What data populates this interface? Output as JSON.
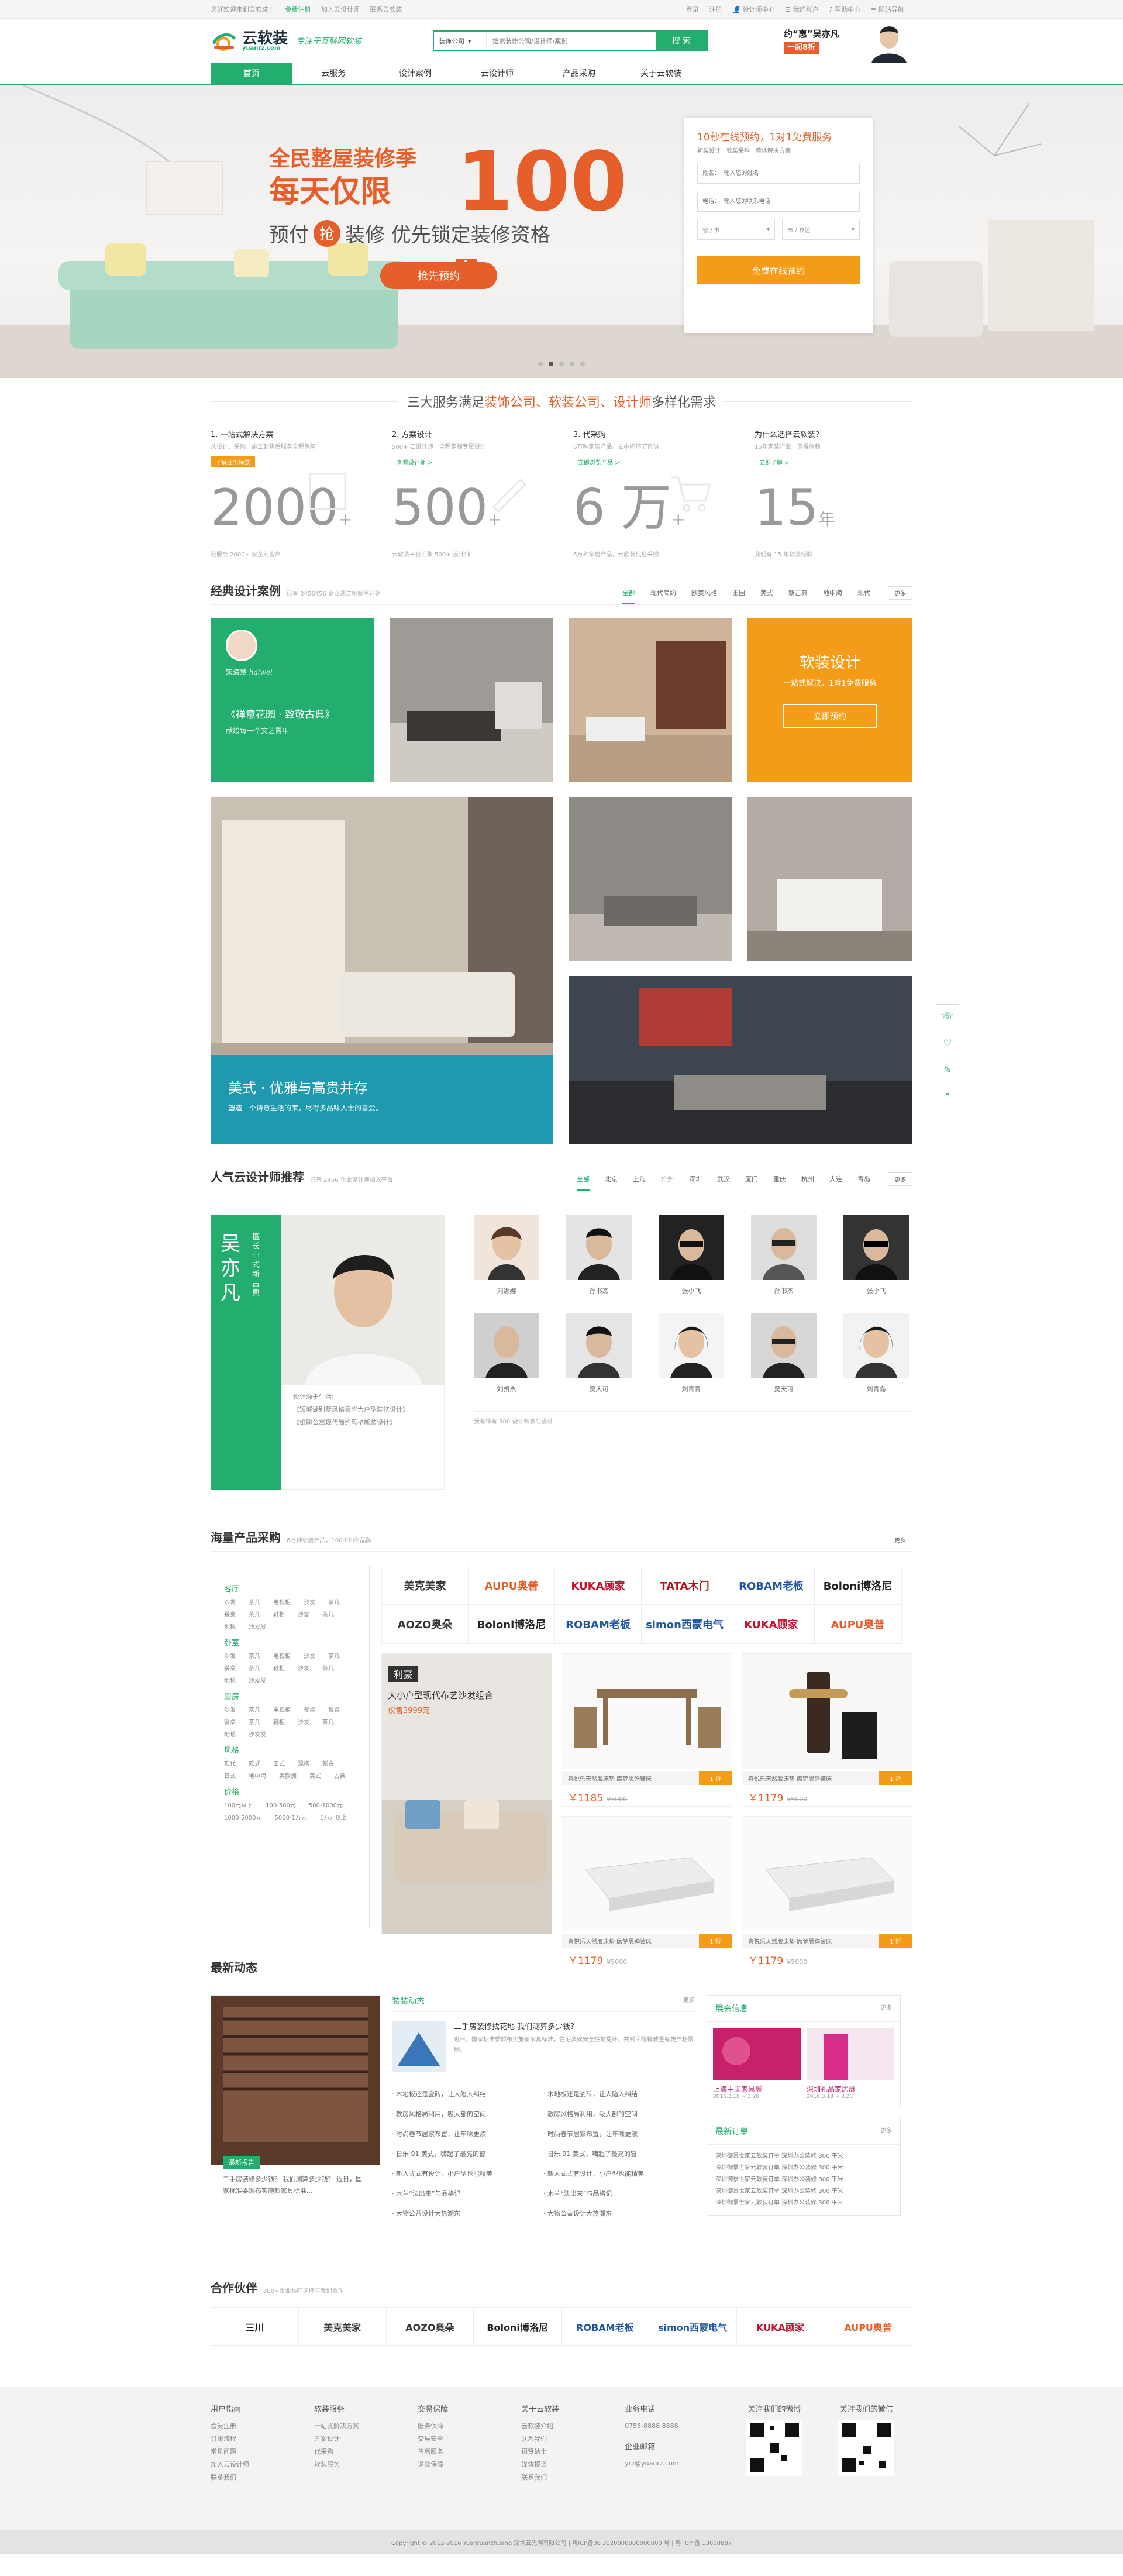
{
  "topbar": {
    "welcome": "您好欢迎来到云软装！",
    "links": [
      "免费注册",
      "加入云设计师",
      "联系云软装"
    ],
    "right": [
      "登录",
      "注册",
      "设计师中心",
      "我的账户",
      "帮助中心",
      "网站导航"
    ]
  },
  "header": {
    "logo_name": "云软装",
    "logo_domain": "yuanrz.com",
    "slogan": "专注于互联网软装",
    "search_category": "装饰公司",
    "search_placeholder": "搜索装修公司/设计师/案例",
    "search_button": "搜 索",
    "promo_line1": "约“惠”吴亦凡",
    "promo_line2": "一起8折"
  },
  "nav": [
    "首页",
    "云服务",
    "设计案例",
    "云设计师",
    "产品采购",
    "关于云软装"
  ],
  "banner": {
    "line1": "全民整屋装修季",
    "line2": "每天仅限",
    "number": "100",
    "unit": "名",
    "line3_a": "预付",
    "line3_circle": "抢",
    "line3_b": "装修  优先锁定装修资格",
    "button": "抢先预约",
    "form": {
      "title": "10秒在线预约，1对1免费服务",
      "tags": [
        "初装设计",
        "软装采购",
        "整体解决方案"
      ],
      "name_placeholder": "姓名：  输入您的姓名",
      "phone_placeholder": "电话：  输入您的联系电话",
      "province": "省 / 市",
      "city": "市 / 县区",
      "submit": "免费在线预约"
    }
  },
  "services": {
    "heading_a": "三大服务满足",
    "heading_hl": "装饰公司、软装公司、设计师",
    "heading_b": "多样化需求",
    "cards": [
      {
        "title": "1. 一站式解决方案",
        "desc": "从设计、采购、施工到售后服务全程保障",
        "tag": "了解业务模式",
        "num": "2000",
        "unit": "+",
        "foot": "已服务 2000+ 家企业客户"
      },
      {
        "title": "2. 方案设计",
        "desc": "500+ 云设计师，全程定制专属设计",
        "tag": "查看设计师 >",
        "num": "500",
        "unit": "+",
        "foot": "云软装平台汇聚 500+ 设计师"
      },
      {
        "title": "3. 代采购",
        "desc": "6万种家居产品，去中间环节直供",
        "tag": "立即浏览产品 >",
        "num": "6 万",
        "unit": "+",
        "foot": "6万种家居产品，云软装代您采购"
      },
      {
        "title": "为什么选择云软装？",
        "desc": "15年家装行业，值得信赖",
        "tag": "立即了解 >",
        "num": "15",
        "unit": "年",
        "foot": "我们有 15 年软装经验"
      }
    ]
  },
  "cases": {
    "title": "经典设计案例",
    "sub": "已有 3456456 企业通过新案例开始",
    "tabs": [
      "全部",
      "现代简约",
      "欧美风格",
      "田园",
      "美式",
      "新古典",
      "地中海",
      "现代"
    ],
    "more": "更多",
    "designer_name": "宋海慧",
    "designer_sign": "haiwei",
    "case_title": "《禅意花园 · 致敬古典》",
    "case_sub": "献给每一个文艺青年",
    "promo_title": "软装设计",
    "promo_sub": "一站式解决，1对1免费服务",
    "promo_btn": "立即预约",
    "feature_title": "美式 · 优雅与高贵并存",
    "feature_sub": "塑造一个诗意生活的家，尽得多品味人士的喜爱。"
  },
  "designers": {
    "title": "人气云设计师推荐",
    "sub": "已有 2456 企业设计师加入平台",
    "tabs": [
      "全部",
      "北京",
      "上海",
      "广州",
      "深圳",
      "武汉",
      "厦门",
      "重庆",
      "杭州",
      "大连",
      "青岛"
    ],
    "more": "更多",
    "star_name": "吴亦凡",
    "star_tag": "擅长中式新古典",
    "star_motto": "设计源于生活!",
    "star_works": [
      "《短城湖别墅风格豪华大户型装修设计》",
      "《维聊公寓现代简约风格新装设计》"
    ],
    "people": [
      "刘娜娜",
      "孙书杰",
      "张小飞",
      "孙书杰",
      "张小飞",
      "刘凯杰",
      "吴大可",
      "刘青青",
      "吴天可",
      "刘青岛"
    ],
    "count_text": "我有将有 900 设计师参与设计"
  },
  "products": {
    "title": "海量产品采购",
    "sub": "6万种家居产品，100个知名品牌",
    "more": "更多",
    "cats": [
      {
        "name": "客厅",
        "items": [
          "沙发",
          "茶几",
          "电视柜",
          "沙发",
          "茶几",
          "餐桌",
          "茶几",
          "鞋柜",
          "沙发",
          "茶几",
          "地毯",
          "沙发发"
        ]
      },
      {
        "name": "卧室",
        "items": [
          "沙发",
          "茶几",
          "电视柜",
          "沙发",
          "茶几",
          "餐桌",
          "茶几",
          "鞋柜",
          "沙发",
          "茶几",
          "地毯",
          "沙发发"
        ]
      },
      {
        "name": "厨房",
        "items": [
          "沙发",
          "茶几",
          "电视柜",
          "餐桌",
          "餐桌",
          "餐桌",
          "茶几",
          "鞋柜",
          "沙发",
          "茶几",
          "地毯",
          "沙发发"
        ]
      },
      {
        "name": "风格",
        "items": [
          "现代",
          "欧式",
          "田式",
          "混搭",
          "新古",
          "日式",
          "地中海",
          "美欧洲",
          "美式",
          "古典"
        ]
      },
      {
        "name": "价格",
        "items": [
          "100元以下",
          "100-500元",
          "500-1000元",
          "1000-5000元",
          "5000-1万元",
          "1万元以上"
        ]
      }
    ],
    "brands": [
      "美克美家",
      "AUPU奥普",
      "KUKA顾家",
      "TATA木门",
      "ROBAM老板",
      "Boloni博洛尼",
      "AOZO奥朵",
      "Boloni博洛尼",
      "ROBAM老板",
      "simon西蒙电气",
      "KUKA顾家",
      "AUPU奥普"
    ],
    "big_badge": "利豪",
    "big_title": "大小户型现代布艺沙发组合",
    "big_price": "仅售3999元",
    "items": [
      {
        "name": "喜悦乐天然胶床垫 席梦思弹簧床",
        "price": "￥1185",
        "old": "¥5000",
        "tag": "1 折"
      },
      {
        "name": "喜悦乐天然胶床垫 席梦思弹簧床",
        "price": "￥1179",
        "old": "¥5000",
        "tag": "1 折"
      },
      {
        "name": "喜悦乐天然胶床垫 席梦思弹簧床",
        "price": "￥1179",
        "old": "¥5000",
        "tag": "1 折"
      },
      {
        "name": "喜悦乐天然胶床垫 席梦思弹簧床",
        "price": "￥1179",
        "old": "¥5000",
        "tag": "1 折"
      }
    ]
  },
  "news": {
    "title": "最新动态",
    "main_badge": "最新报告",
    "main_text": "二手房装修多少钱？ 我们测算多少钱？ 近日，国家标准委颁布实施新家具标准...",
    "col_title": "装装动态",
    "more": "更多",
    "top_title": "二手房装修找花地 我们测算多少钱?",
    "top_text": "近日，国家标准委颁布实施新家具标准，住宅装修安全性能提升，并对甲醛释放量有更严格限制。",
    "list_a": [
      "木地板还是瓷砖，让人陷入纠结",
      "教房风格局利用，吸大部的空间",
      "时尚春节居家布置，让年味更浓",
      "日乐 91 美式，嗨起了最亮的窗",
      "新人式式有设计，小户型也能精美",
      "木兰“法出来”与品格记",
      "大物公益设计大热潮东"
    ],
    "list_b": [
      "木地板还是瓷砖，让人陷入纠结",
      "教房风格局利用，吸大部的空间",
      "时尚春节居家布置，让年味更浓",
      "日乐 91 美式，嗨起了最亮的窗",
      "新人式式有设计，小户型也能精美",
      "木兰“法出来”与品格记",
      "大物公益设计大热潮东"
    ],
    "fair_title": "展会信息",
    "fairs": [
      {
        "name": "上海中国家具展",
        "date": "2016.3.18 ~ 3.20"
      },
      {
        "name": "深圳礼品家居展",
        "date": "2016.3.18 ~ 3.20"
      }
    ],
    "orders_title": "最新订单",
    "orders": [
      "深圳御景世家云软装订单  深圳办公装修 300 平米",
      "深圳御景世家云软装订单  深圳办公装修 300 平米",
      "深圳御景世家云软装订单  深圳办公装修 300 平米",
      "深圳御景世家云软装订单  深圳办公装修 300 平米",
      "深圳御景世家云软装订单  深圳办公装修 300 平米"
    ]
  },
  "partners": {
    "title": "合作伙伴",
    "sub": "300+企业共同选择与我们合作",
    "brands": [
      "三川",
      "美克美家",
      "AOZO奥朵",
      "Boloni博洛尼",
      "ROBAM老板",
      "simon西蒙电气",
      "KUKA顾家",
      "AUPU奥普"
    ]
  },
  "footer": {
    "cols": [
      {
        "title": "用户指南",
        "items": [
          "会员注册",
          "订单流程",
          "常见问题",
          "加入云设计师",
          "联系我们"
        ]
      },
      {
        "title": "软装服务",
        "items": [
          "一站式解决方案",
          "方案设计",
          "代采购",
          "软装服务"
        ]
      },
      {
        "title": "交易保障",
        "items": [
          "服务保障",
          "交易安全",
          "售后服务",
          "退款保障"
        ]
      },
      {
        "title": "关于云软装",
        "items": [
          "云软装介绍",
          "联系我们",
          "招贤纳士",
          "媒体报道",
          "联系我们"
        ]
      }
    ],
    "phone_title": "业务电话",
    "phone": "0755-8888 8888",
    "mail_title": "企业邮箱",
    "mail": "yrz@yuanrz.com",
    "qr1": "关注我们的微博",
    "qr2": "关注我们的微信",
    "copyright": "Copyright © 2012-2016 Yuanruanzhuang  深圳云先网有限公司  |  粤ICP备08  3020000000000000 号  |  粤 ICP 备 13008887"
  },
  "colors": {
    "green": "#23ad6e",
    "orange": "#f49c17",
    "red": "#e65f2a"
  }
}
